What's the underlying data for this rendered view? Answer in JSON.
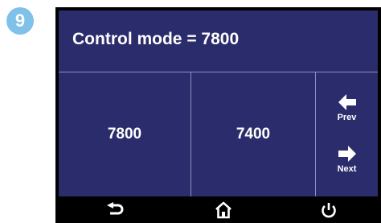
{
  "step": {
    "number": "9",
    "color": "#7fc1e8"
  },
  "screen": {
    "title": "Control mode = 7800",
    "background": "#2b2c6b",
    "options": [
      "7800",
      "7400"
    ],
    "nav": {
      "prev_label": "Prev",
      "next_label": "Next"
    }
  },
  "bottom_bar": {
    "icons": [
      "back-arrow-icon",
      "home-icon",
      "power-icon"
    ]
  }
}
